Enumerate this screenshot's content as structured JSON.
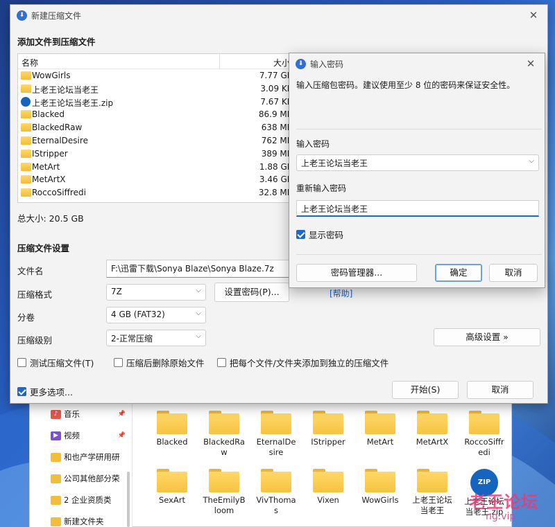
{
  "colors": {
    "accent": "#1f67c9",
    "folder": "#f7c342",
    "watermark": "#e63c78"
  },
  "explorer": {
    "nav": [
      {
        "label": "音乐",
        "icon": "music-icon",
        "pinned": true
      },
      {
        "label": "视频",
        "icon": "video-icon",
        "pinned": true
      },
      {
        "label": "和也产学研用研",
        "icon": "folder-icon",
        "pinned": false
      },
      {
        "label": "公司其他部分荣",
        "icon": "folder-icon",
        "pinned": false
      },
      {
        "label": "2 企业资质类",
        "icon": "folder-icon",
        "pinned": false
      },
      {
        "label": "新建文件夹",
        "icon": "folder-icon",
        "pinned": false
      }
    ],
    "tiles": [
      "Blacked",
      "BlackedRaw",
      "EternalDesire",
      "IStripper",
      "MetArt",
      "MetArtX",
      "RoccoSiffredi",
      "SexArt",
      "TheEmilyBloom",
      "VivThomas",
      "Vixen",
      "WowGirls",
      "上老王论坛当老王",
      "上老王论坛当老王.zip"
    ],
    "tile_lines": [
      [
        "Blacked"
      ],
      [
        "BlackedRa",
        "w"
      ],
      [
        "EternalDe",
        "sire"
      ],
      [
        "IStripper"
      ],
      [
        "MetArt"
      ],
      [
        "MetArtX"
      ],
      [
        "RoccoSiffr",
        "edi"
      ],
      [
        "SexArt"
      ],
      [
        "TheEmilyB",
        "loom"
      ],
      [
        "VivThoma",
        "s"
      ],
      [
        "Vixen"
      ],
      [
        "WowGirls"
      ],
      [
        "上老王论坛",
        "当老王"
      ],
      [
        "上老王论坛",
        "当老王.zip"
      ]
    ]
  },
  "watermark": {
    "text": "老王论坛",
    "url": "ng.vip"
  },
  "main_dialog": {
    "title": "新建压缩文件",
    "add_section_title": "添加文件到压缩文件",
    "list_header": {
      "name": "名称",
      "size": "大小"
    },
    "files": [
      {
        "name": "WowGirls",
        "size": "7.77 GB",
        "type": "folder"
      },
      {
        "name": "上老王论坛当老王",
        "size": "3.09 KB",
        "type": "folder"
      },
      {
        "name": "上老王论坛当老王.zip",
        "size": "7.67 KB",
        "type": "zip"
      },
      {
        "name": "Blacked",
        "size": "86.9 MB",
        "type": "folder"
      },
      {
        "name": "BlackedRaw",
        "size": "638 MB",
        "type": "folder"
      },
      {
        "name": "EternalDesire",
        "size": "762 MB",
        "type": "folder"
      },
      {
        "name": "IStripper",
        "size": "389 MB",
        "type": "folder"
      },
      {
        "name": "MetArt",
        "size": "1.88 GB",
        "type": "folder"
      },
      {
        "name": "MetArtX",
        "size": "3.46 GB",
        "type": "folder"
      },
      {
        "name": "RoccoSiffredi",
        "size": "32.8 MB",
        "type": "folder"
      }
    ],
    "total_size": "总大小: 20.5 GB",
    "settings_title": "压缩文件设置",
    "filename_label": "文件名",
    "filename_value": "F:\\迅雷下载\\Sonya Blaze\\Sonya Blaze.7z",
    "format_label": "压缩格式",
    "format_value": "7Z",
    "set_password_button": "设置密码(P)...",
    "help_link": "[帮助]",
    "split_label": "分卷",
    "split_value": "4 GB (FAT32)",
    "level_label": "压缩级别",
    "level_value": "2-正常压缩",
    "advanced_button": "高级设置 »",
    "test_checkbox": "测试压缩文件(T)",
    "delete_checkbox": "压缩后删除原始文件",
    "separate_checkbox": "把每个文件/文件夹添加到独立的压缩文件",
    "more_options": "更多选项...",
    "start_button": "开始(S)",
    "cancel_button": "取消"
  },
  "password_dialog": {
    "title": "输入密码",
    "description": "输入压缩包密码。建议使用至少 8 位的密码来保证安全性。",
    "enter_label": "输入密码",
    "enter_value": "上老王论坛当老王",
    "reenter_label": "重新输入密码",
    "reenter_value": "上老王论坛当老王",
    "show_password": "显示密码",
    "manager_button": "密码管理器...",
    "ok_button": "确定",
    "cancel_button": "取消"
  }
}
